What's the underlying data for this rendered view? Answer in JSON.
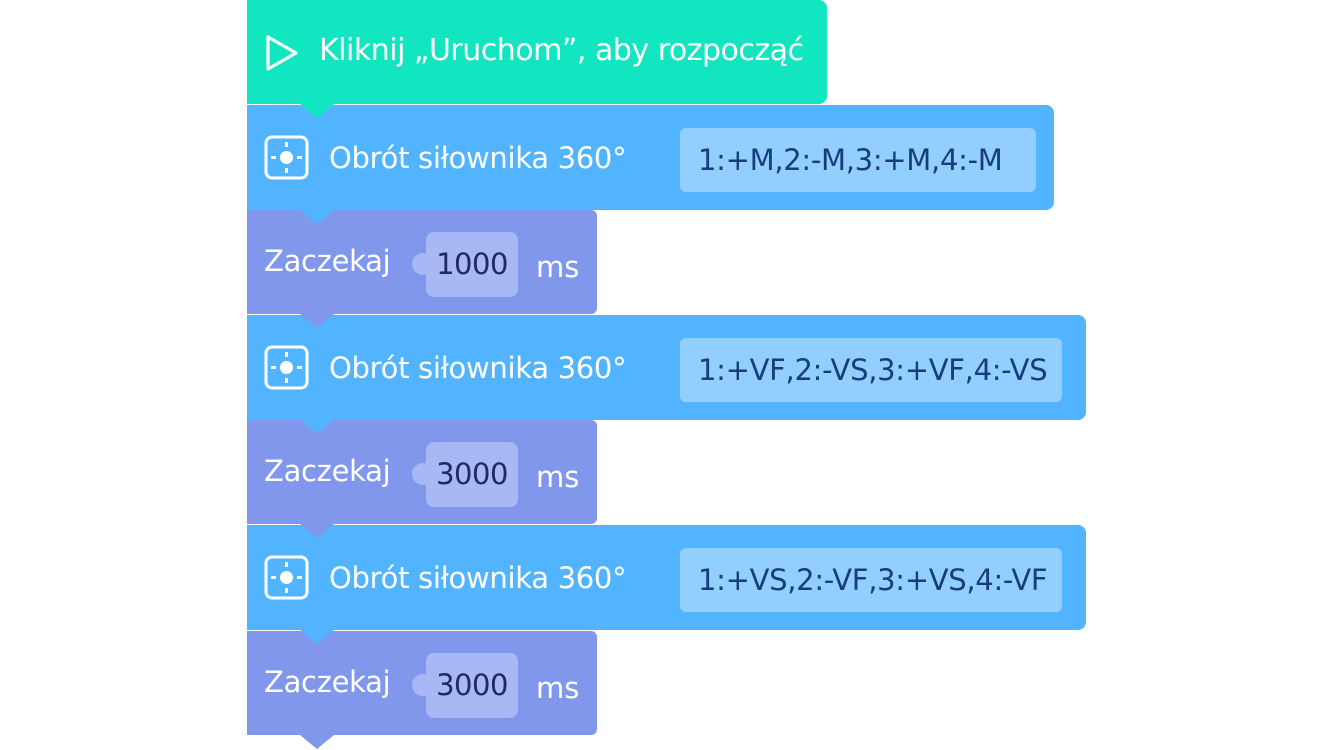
{
  "start_block": {
    "label": "Kliknij „Uruchom”, aby rozpocząć",
    "icon": "play-icon",
    "color": "#12e6c0"
  },
  "blocks": [
    {
      "type": "rotation",
      "label": "Obrót siłownika 360°",
      "value": "1:+M,2:-M,3:+M,4:-M",
      "icon": "servo-icon",
      "color": "#52b4ff"
    },
    {
      "type": "wait",
      "label": "Zaczekaj",
      "value": "1000",
      "unit": "ms",
      "color": "#8197ec"
    },
    {
      "type": "rotation",
      "label": "Obrót siłownika 360°",
      "value": "1:+VF,2:-VS,3:+VF,4:-VS",
      "icon": "servo-icon",
      "color": "#52b4ff"
    },
    {
      "type": "wait",
      "label": "Zaczekaj",
      "value": "3000",
      "unit": "ms",
      "color": "#8197ec"
    },
    {
      "type": "rotation",
      "label": "Obrót siłownika 360°",
      "value": "1:+VS,2:-VF,3:+VS,4:-VF",
      "icon": "servo-icon",
      "color": "#52b4ff"
    },
    {
      "type": "wait",
      "label": "Zaczekaj",
      "value": "3000",
      "unit": "ms",
      "color": "#8197ec"
    }
  ]
}
